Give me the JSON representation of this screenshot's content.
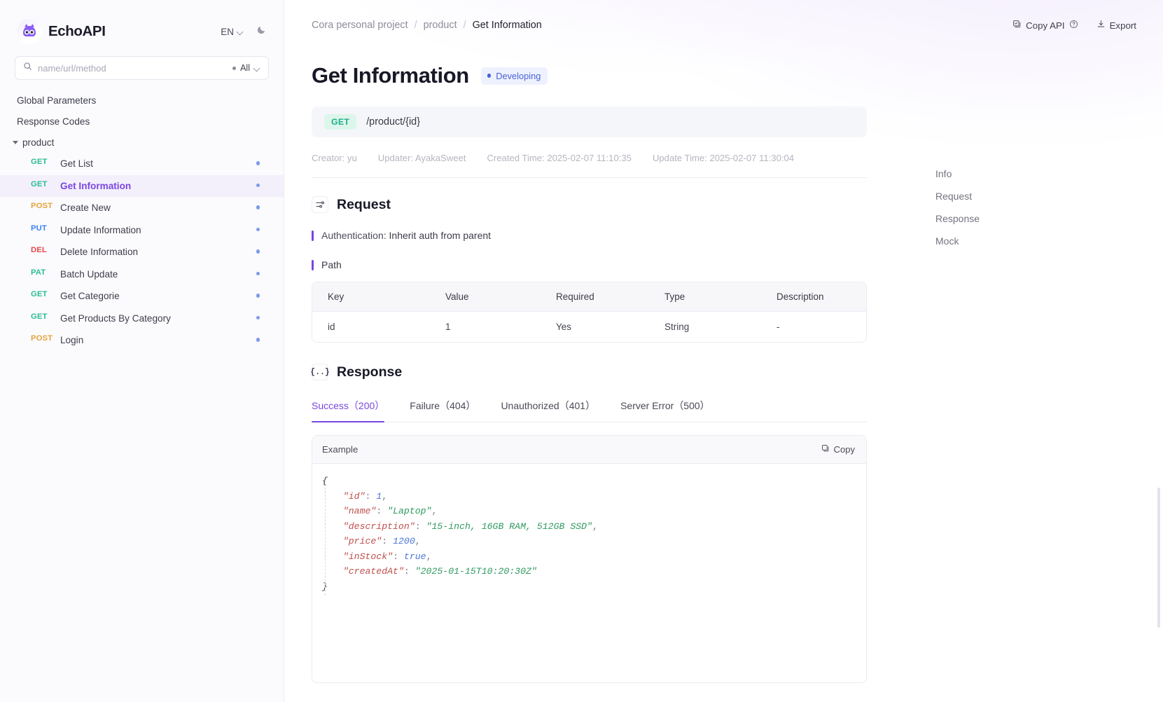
{
  "app": {
    "brand": "EchoAPI",
    "language": "EN",
    "theme_icon": "moon-icon"
  },
  "sidebar": {
    "search": {
      "placeholder": "name/url/method",
      "value": "",
      "filter_label": "All"
    },
    "top_items": [
      {
        "label": "Global Parameters"
      },
      {
        "label": "Response Codes"
      }
    ],
    "folder": {
      "label": "product",
      "expanded": true
    },
    "apis": [
      {
        "method": "GET",
        "label": "Get List",
        "active": false
      },
      {
        "method": "GET",
        "label": "Get Information",
        "active": true
      },
      {
        "method": "POST",
        "label": "Create New",
        "active": false
      },
      {
        "method": "PUT",
        "label": "Update Information",
        "active": false
      },
      {
        "method": "DEL",
        "label": "Delete Information",
        "active": false
      },
      {
        "method": "PAT",
        "label": "Batch Update",
        "active": false
      },
      {
        "method": "GET",
        "label": "Get Categorie",
        "active": false
      },
      {
        "method": "GET",
        "label": "Get Products By Category",
        "active": false
      },
      {
        "method": "POST",
        "label": "Login",
        "active": false
      }
    ],
    "method_colors": {
      "GET": "#2bbd94",
      "POST": "#e8a33d",
      "PUT": "#3b82f6",
      "DEL": "#e5484d",
      "PAT": "#2bbd94"
    }
  },
  "topbar": {
    "breadcrumbs": [
      {
        "label": "Cora personal project"
      },
      {
        "label": "product"
      },
      {
        "label": "Get Information"
      }
    ],
    "separator": "/",
    "copy_api_label": "Copy API",
    "export_label": "Export"
  },
  "page": {
    "title": "Get Information",
    "status": "Developing",
    "method": "GET",
    "path": "/product/{id}",
    "meta": [
      "Creator: yu",
      "Updater: AyakaSweet",
      "Created Time: 2025-02-07 11:10:35",
      "Update Time: 2025-02-07 11:30:04"
    ]
  },
  "request": {
    "title": "Request",
    "auth_label": "Authentication: ",
    "auth_value": "Inherit auth from parent",
    "path_label": "Path",
    "table": {
      "headers": [
        "Key",
        "Value",
        "Required",
        "Type",
        "Description"
      ],
      "rows": [
        {
          "key": "id",
          "value": "1",
          "required": "Yes",
          "type": "String",
          "description": "-"
        }
      ]
    }
  },
  "response": {
    "title": "Response",
    "tabs": [
      {
        "label": "Success（200）",
        "active": true
      },
      {
        "label": "Failure（404）",
        "active": false
      },
      {
        "label": "Unauthorized（401）",
        "active": false
      },
      {
        "label": "Server Error（500）",
        "active": false
      }
    ],
    "example_label": "Example",
    "copy_label": "Copy",
    "json": {
      "open": "{",
      "close": "}",
      "fields": [
        {
          "key": "\"id\"",
          "sep": ": ",
          "value": "1",
          "kind": "n",
          "comma": ","
        },
        {
          "key": "\"name\"",
          "sep": ": ",
          "value": "\"Laptop\"",
          "kind": "s",
          "comma": ","
        },
        {
          "key": "\"description\"",
          "sep": ": ",
          "value": "\"15-inch, 16GB RAM, 512GB SSD\"",
          "kind": "s",
          "comma": ","
        },
        {
          "key": "\"price\"",
          "sep": ": ",
          "value": "1200",
          "kind": "n",
          "comma": ","
        },
        {
          "key": "\"inStock\"",
          "sep": ": ",
          "value": "true",
          "kind": "n",
          "comma": ","
        },
        {
          "key": "\"createdAt\"",
          "sep": ": ",
          "value": "\"2025-01-15T10:20:30Z\"",
          "kind": "s",
          "comma": ""
        }
      ]
    }
  },
  "rail": {
    "items": [
      {
        "label": "Info"
      },
      {
        "label": "Request"
      },
      {
        "label": "Response"
      },
      {
        "label": "Mock"
      }
    ]
  },
  "colors": {
    "accent": "#7a46e0",
    "get": "#2bbd94",
    "status": "#4a63d8"
  }
}
